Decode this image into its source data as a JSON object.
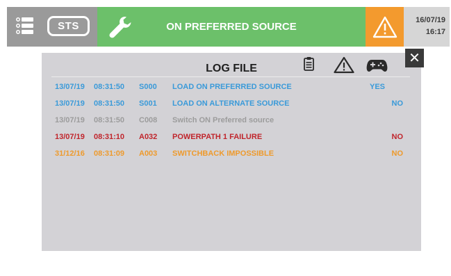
{
  "header": {
    "sts_label": "STS",
    "status_text": "ON PREFERRED SOURCE",
    "date": "16/07/19",
    "time": "16:17",
    "colors": {
      "menu_bg": "#9a9a9a",
      "status_bg": "#6cc06a",
      "alarm_bg": "#f39a2e",
      "datetime_bg": "#d6d6d6"
    },
    "icons": {
      "menu": "list-menu-icon",
      "wrench": "wrench-icon",
      "alarm": "warning-triangle-icon"
    }
  },
  "log_panel": {
    "title": "LOG FILE",
    "header_icons": [
      "clipboard-icon",
      "warning-icon",
      "gamepad-icon"
    ],
    "close_label": "✕",
    "rows": [
      {
        "date": "13/07/19",
        "time": "08:31:50",
        "code": "S000",
        "message": "LOAD ON PREFERRED SOURCE",
        "value": "YES",
        "color": "#3a9ad9"
      },
      {
        "date": "13/07/19",
        "time": "08:31:50",
        "code": "S001",
        "message": "LOAD ON ALTERNATE SOURCE",
        "value": "NO",
        "color": "#3a9ad9"
      },
      {
        "date": "13/07/19",
        "time": "08:31:50",
        "code": "C008",
        "message": "Switch ON Preferred source",
        "value": "",
        "color": "#9c9c9c"
      },
      {
        "date": "13/07/19",
        "time": "08:31:10",
        "code": "A032",
        "message": "POWERPATH 1 FAILURE",
        "value": "NO",
        "color": "#c0252c"
      },
      {
        "date": "31/12/16",
        "time": "08:31:09",
        "code": "A003",
        "message": "SWITCHBACK IMPOSSIBLE",
        "value": "NO",
        "color": "#ee9a2c"
      }
    ]
  }
}
